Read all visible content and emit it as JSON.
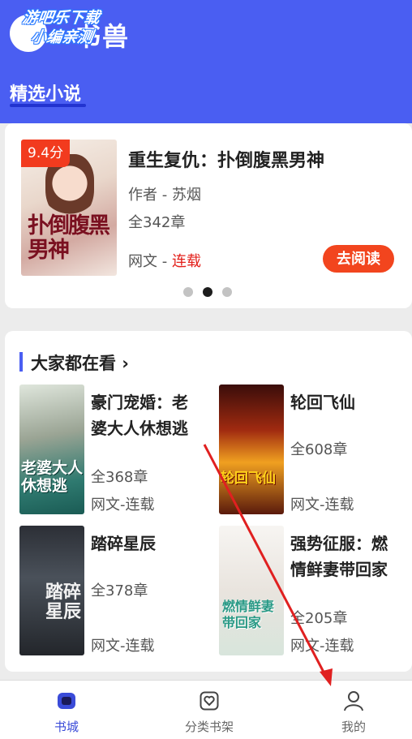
{
  "header": {
    "app_title": "书兽",
    "watermark_line1": "游吧乐下载",
    "watermark_line2": "小编亲测",
    "section_title": "精选小说"
  },
  "featured": {
    "score": "9.4分",
    "cover_text": "扑倒腹黑男神",
    "title": "重生复仇：扑倒腹黑男神",
    "author": "作者 - 苏烟",
    "chapters": "全342章",
    "tag_prefix": "网文 - ",
    "tag_status": "连载",
    "read_button": "去阅读"
  },
  "popular": {
    "title": "大家都在看 ›",
    "books": [
      {
        "title": "豪门宠婚：老婆大人休想逃",
        "chapters": "全368章",
        "tag": "网文-连载",
        "cover_text": "老婆大人休想逃"
      },
      {
        "title": "轮回飞仙",
        "chapters": "全608章",
        "tag": "网文-连载",
        "cover_text": "轮回飞仙"
      },
      {
        "title": "踏碎星辰",
        "chapters": "全378章",
        "tag": "网文-连载",
        "cover_text": "踏碎星辰"
      },
      {
        "title": "强势征服：燃情鲜妻带回家",
        "chapters": "全205章",
        "tag": "网文-连载",
        "cover_text": "燃情鲜妻带回家"
      }
    ]
  },
  "nav": {
    "items": [
      {
        "label": "书城",
        "icon": "bookstore-icon"
      },
      {
        "label": "分类书架",
        "icon": "bookshelf-icon"
      },
      {
        "label": "我的",
        "icon": "profile-icon"
      }
    ]
  },
  "colors": {
    "brand": "#4a5ef2",
    "accent": "#f2451e",
    "status_red": "#e3201b"
  }
}
